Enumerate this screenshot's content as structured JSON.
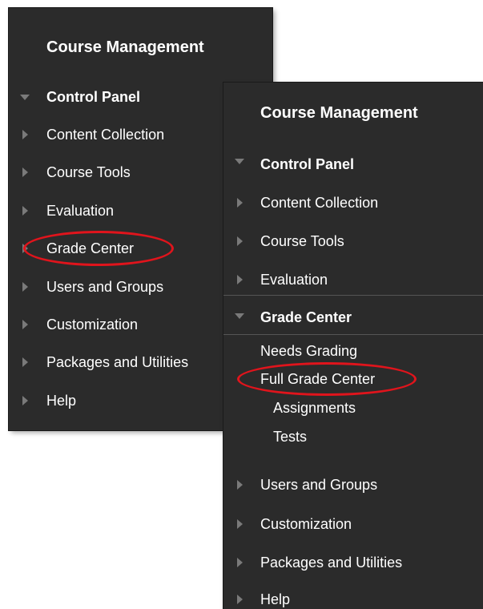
{
  "left_panel": {
    "title": "Course Management",
    "items": [
      {
        "label": "Control Panel",
        "expanded": true
      },
      {
        "label": "Content Collection"
      },
      {
        "label": "Course Tools"
      },
      {
        "label": "Evaluation"
      },
      {
        "label": "Grade Center",
        "highlighted": true
      },
      {
        "label": "Users and Groups"
      },
      {
        "label": "Customization"
      },
      {
        "label": "Packages and Utilities"
      },
      {
        "label": "Help"
      }
    ]
  },
  "right_panel": {
    "title": "Course Management",
    "items": [
      {
        "label": "Control Panel",
        "expanded": true
      },
      {
        "label": "Content Collection"
      },
      {
        "label": "Course Tools"
      },
      {
        "label": "Evaluation"
      },
      {
        "label": "Grade Center",
        "expanded": true
      },
      {
        "label": "Users and Groups"
      },
      {
        "label": "Customization"
      },
      {
        "label": "Packages and Utilities"
      },
      {
        "label": "Help"
      }
    ],
    "grade_center_subitems": [
      {
        "label": "Needs Grading"
      },
      {
        "label": "Full Grade Center",
        "highlighted": true
      },
      {
        "label": "Assignments"
      },
      {
        "label": "Tests"
      }
    ]
  },
  "colors": {
    "panel_background": "#2b2b2b",
    "text": "#ffffff",
    "arrow": "#7a7a7a",
    "highlight_circle": "#e0141c"
  },
  "icons": {
    "expand": "triangle-right-icon",
    "collapse": "triangle-down-icon"
  }
}
